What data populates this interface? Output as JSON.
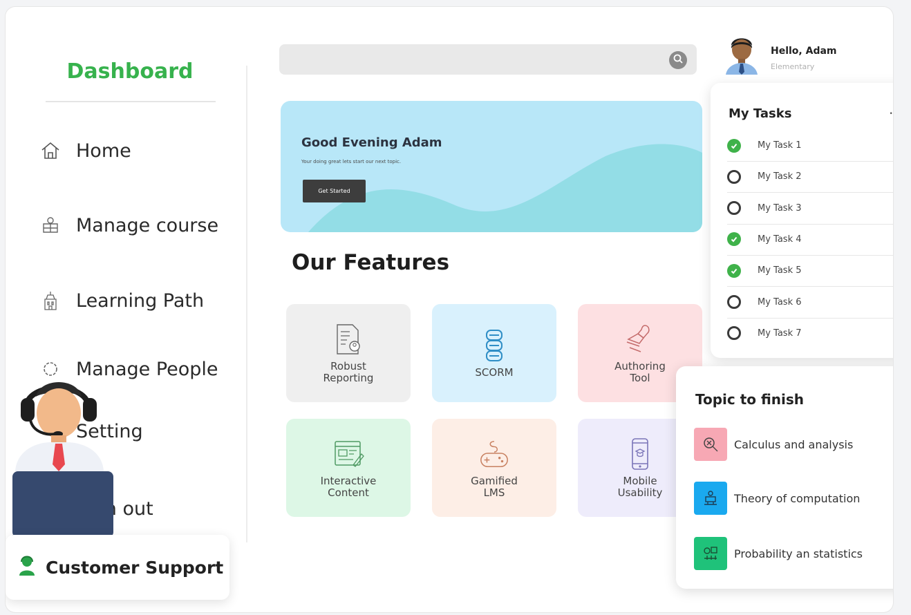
{
  "sidebar": {
    "brand": "Dashboard",
    "items": [
      {
        "label": "Home",
        "icon": "home-icon"
      },
      {
        "label": "Manage course",
        "icon": "course-icon"
      },
      {
        "label": "Learning Path",
        "icon": "path-icon"
      },
      {
        "label": "Manage People",
        "icon": "people-icon"
      },
      {
        "label": "Setting",
        "icon": "gear-icon"
      },
      {
        "label": "Sign out",
        "icon": "signout-icon"
      }
    ],
    "support_label": "Customer Support"
  },
  "header": {
    "search_placeholder": "",
    "greeting": "Hello, Adam",
    "level": "Elementary"
  },
  "banner": {
    "title": "Good Evening Adam",
    "subtitle": "Your doing great lets start our next topic.",
    "button": "Get Started"
  },
  "features": {
    "title": "Our Features",
    "cards": [
      {
        "line1": "Robust",
        "line2": "Reporting",
        "bg": "#efefef",
        "icon": "report-icon"
      },
      {
        "line1": "SCORM",
        "line2": "",
        "bg": "#d9f1fd",
        "icon": "scorm-icon"
      },
      {
        "line1": "Authoring",
        "line2": "Tool",
        "bg": "#fde0e2",
        "icon": "stamp-icon"
      },
      {
        "line1": "Interactive",
        "line2": "Content",
        "bg": "#ddf7e6",
        "icon": "content-icon"
      },
      {
        "line1": "Gamified",
        "line2": "LMS",
        "bg": "#fdeee6",
        "icon": "gamepad-icon"
      },
      {
        "line1": "Mobile",
        "line2": "Usability",
        "bg": "#eeecfb",
        "icon": "mobile-icon"
      }
    ]
  },
  "tasks": {
    "title": "My Tasks",
    "more": "...",
    "items": [
      {
        "label": "My Task 1",
        "done": true,
        "starred": true
      },
      {
        "label": "My Task 2",
        "done": false,
        "starred": false
      },
      {
        "label": "My Task 3",
        "done": false,
        "starred": false
      },
      {
        "label": "My Task 4",
        "done": true,
        "starred": false
      },
      {
        "label": "My Task 5",
        "done": true,
        "starred": true
      },
      {
        "label": "My Task 6",
        "done": false,
        "starred": true
      },
      {
        "label": "My Task 7",
        "done": false,
        "starred": false
      }
    ]
  },
  "topics": {
    "title": "Topic to finish",
    "items": [
      {
        "label": "Calculus and analysis",
        "color": "#f7a8b4",
        "icon": "calculus-icon"
      },
      {
        "label": "Theory of computation",
        "color": "#1aa9ef",
        "icon": "computation-icon"
      },
      {
        "label": "Probability an statistics",
        "color": "#1fc27a",
        "icon": "statistics-icon"
      }
    ]
  },
  "colors": {
    "brand_green": "#37b24d",
    "star_filled": "#f6b21b",
    "star_empty": "#f3cf6c",
    "task_done": "#3fb24a"
  }
}
